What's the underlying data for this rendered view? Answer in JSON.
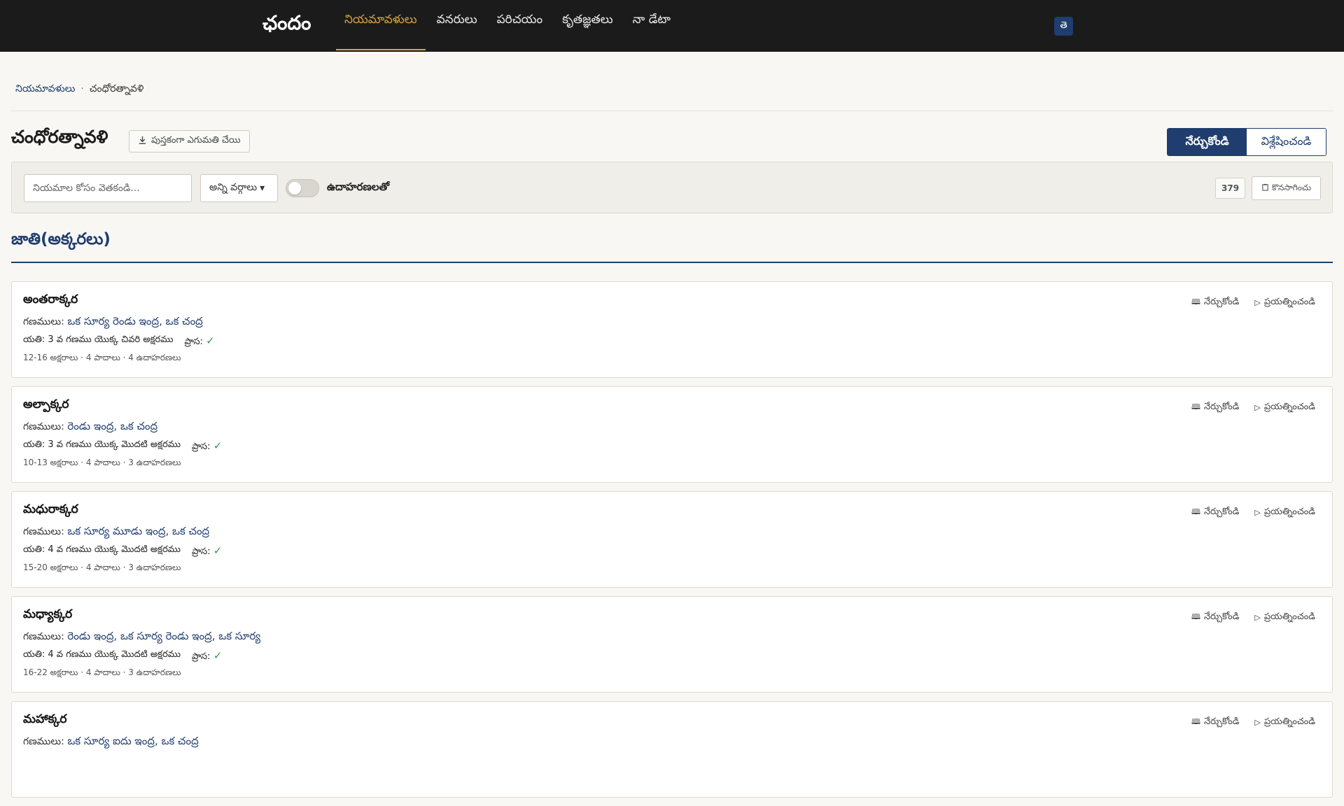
{
  "header": {
    "brand": "ఛందం",
    "nav": [
      "నియమావళులు",
      "వనరులు",
      "పరిచయం",
      "కృతజ్ఞతలు",
      "నా డేటా"
    ],
    "active_nav": 0,
    "lang_button": "తె"
  },
  "breadcrumb": {
    "root": "నియమావళులు",
    "current": "చంధోరత్నావళి"
  },
  "page": {
    "title": "చంధోరత్నావళి",
    "download_label": "పుస్తకంగా ఎగుమతి చేయి",
    "mode_learn": "నేర్చుకోండి",
    "mode_analyze": "విశ్లేషించండి"
  },
  "filters": {
    "search_placeholder": "నియమాల కోసం వెతకండి...",
    "category_value": "అన్ని వర్గాలు",
    "examples_toggle_label": "ఉదాహరణలతో",
    "examples_toggle_on": false,
    "count": "379",
    "export_label": "కొనసాగించు"
  },
  "section": {
    "title": "జాతి(అక్కరలు)"
  },
  "actions": {
    "learn": "నేర్చుకోండి",
    "try": "ప్రయత్నించండి"
  },
  "labels": {
    "ganas": "గణములు:",
    "yati": "యతి:",
    "prasa": "ప్రాస:",
    "check": "✓"
  },
  "colors": {
    "accent": "#1f3d6e",
    "nav_active": "#d9a43a",
    "check": "#2a9b4a"
  },
  "cards": [
    {
      "name": "అంతరాక్కర",
      "ganas": "ఒక సూర్య రెండు ఇంద్ర, ఒక చంద్ర",
      "yati": "3 వ గణము యొక్క చివరి అక్షరము",
      "meta": "12-16 అక్షరాలు · 4 పాదాలు · 4 ఉదాహరణలు"
    },
    {
      "name": "అల్పాక్కర",
      "ganas": "రెండు ఇంద్ర, ఒక చంద్ర",
      "yati": "3 వ గణము యొక్క మొదటి అక్షరము",
      "meta": "10-13 అక్షరాలు · 4 పాదాలు · 3 ఉదాహరణలు"
    },
    {
      "name": "మధురాక్కర",
      "ganas": "ఒక సూర్య మూడు ఇంద్ర, ఒక చంద్ర",
      "yati": "4 వ గణము యొక్క మొదటి అక్షరము",
      "meta": "15-20 అక్షరాలు · 4 పాదాలు · 3 ఉదాహరణలు"
    },
    {
      "name": "మధ్యాక్కర",
      "ganas": "రెండు ఇంద్ర, ఒక సూర్య రెండు ఇంద్ర, ఒక సూర్య",
      "yati": "4 వ గణము యొక్క మొదటి అక్షరము",
      "meta": "16-22 అక్షరాలు · 4 పాదాలు · 3 ఉదాహరణలు"
    },
    {
      "name": "మహాక్కర",
      "ganas": "ఒక సూర్య ఐదు ఇంద్ర, ఒక చంద్ర",
      "yati": "",
      "meta": ""
    }
  ]
}
